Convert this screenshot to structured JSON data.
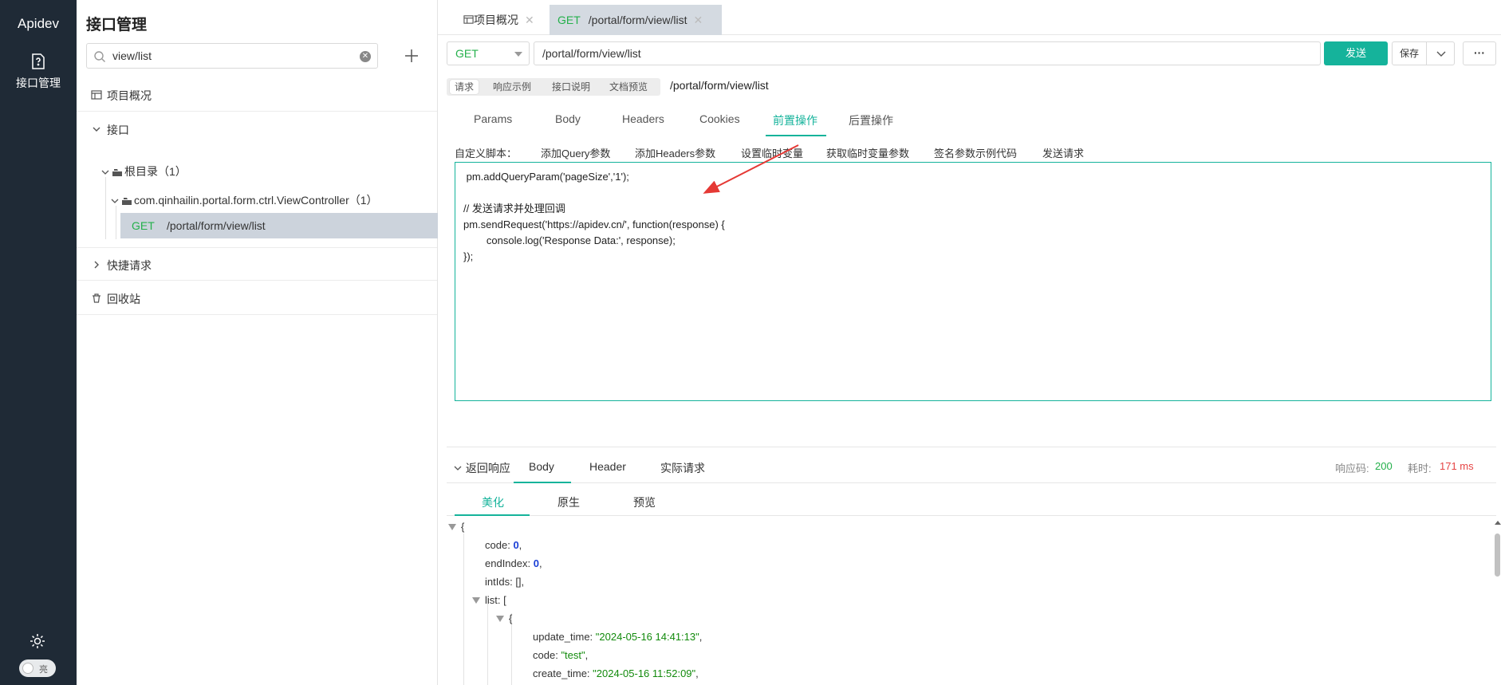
{
  "rail": {
    "brand": "Apidev",
    "nav_label": "接口管理",
    "theme_toggle_label": "亮"
  },
  "sidebar": {
    "title": "接口管理",
    "search_value": "view/list",
    "items": {
      "overview": "项目概况",
      "api": "接口",
      "root": "根目录（1）",
      "controller": "com.qinhailin.portal.form.ctrl.ViewController（1）",
      "leaf_method": "GET",
      "leaf_path": "/portal/form/view/list",
      "quick": "快捷请求",
      "trash": "回收站"
    }
  },
  "doc_tabs": [
    {
      "label": "项目概况"
    },
    {
      "method": "GET",
      "label": "/portal/form/view/list"
    }
  ],
  "request": {
    "method": "GET",
    "url": "/portal/form/view/list",
    "send_label": "发送",
    "save_label": "保存",
    "more_label": "···",
    "sub_tabs": [
      "请求",
      "响应示例",
      "接口说明",
      "文档预览"
    ],
    "route_label": "/portal/form/view/list",
    "tabs": [
      "Params",
      "Body",
      "Headers",
      "Cookies",
      "前置操作",
      "后置操作"
    ],
    "script_label": "自定义脚本：",
    "script_actions": [
      "添加Query参数",
      "添加Headers参数",
      "设置临时变量",
      "获取临时变量参数",
      "签名参数示例代码",
      "发送请求"
    ],
    "script_code": " pm.addQueryParam('pageSize','1');\n\n// 发送请求并处理回调\npm.sendRequest('https://apidev.cn/', function(response) {\n        console.log('Response Data:', response);\n});"
  },
  "response": {
    "toggle_label": "返回响应",
    "tabs": [
      "Body",
      "Header",
      "实际请求"
    ],
    "code_label": "响应码:",
    "code_value": "200",
    "time_label": "耗时:",
    "time_value": "171 ms",
    "view_tabs": [
      "美化",
      "原生",
      "预览"
    ],
    "json": {
      "open_brace": "{",
      "code_key": "code:",
      "code_val": "0",
      "endIndex_key": "endIndex:",
      "endIndex_val": "0",
      "intIds_key": "intIds:",
      "intIds_val": "[],",
      "list_key": "list:",
      "list_open": "[",
      "item_open": "{",
      "update_time_key": "update_time:",
      "update_time_val": "\"2024-05-16 14:41:13\"",
      "item_code_key": "code:",
      "item_code_val": "\"test\"",
      "create_time_key": "create_time:",
      "create_time_val": "\"2024-05-16 11:52:09\""
    }
  },
  "colors": {
    "accent": "#15b39b",
    "get_method": "#24b04b",
    "status_ok": "#24b04b",
    "time_red": "#e64545",
    "rail_bg": "#1f2a36"
  }
}
